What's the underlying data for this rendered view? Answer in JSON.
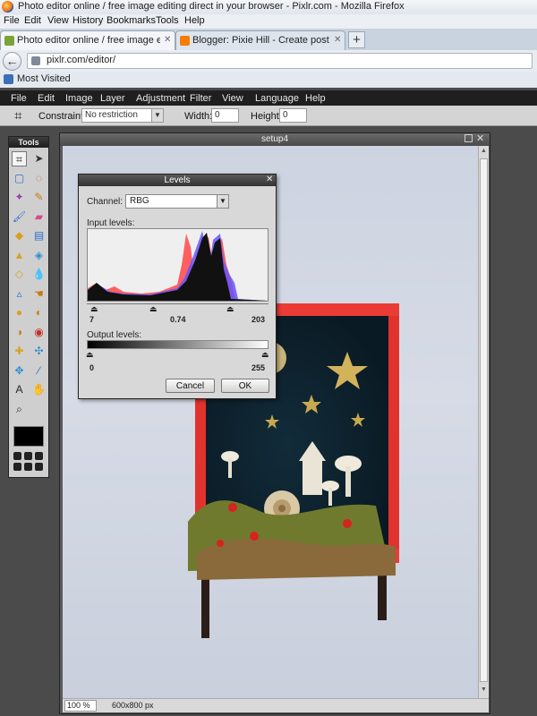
{
  "window": {
    "title": "Photo editor online / free image editing direct in your browser - Pixlr.com - Mozilla Firefox"
  },
  "browser_menu": [
    "File",
    "Edit",
    "View",
    "History",
    "Bookmarks",
    "Tools",
    "Help"
  ],
  "tabs": [
    {
      "label": "Photo editor online / free image editi...",
      "active": true
    },
    {
      "label": "Blogger: Pixie Hill - Create post",
      "active": false
    }
  ],
  "address": {
    "url": "pixlr.com/editor/"
  },
  "bookmarks": {
    "most_visited": "Most Visited"
  },
  "app_menu": [
    "File",
    "Edit",
    "Image",
    "Layer",
    "Adjustment",
    "Filter",
    "View",
    "Language",
    "Help"
  ],
  "options": {
    "constraint_label": "Constraint:",
    "constraint_value": "No restriction",
    "width_label": "Width:",
    "width_value": "0",
    "height_label": "Height:",
    "height_value": "0"
  },
  "tools_panel": {
    "title": "Tools",
    "icons": [
      "crop-icon",
      "move-icon",
      "marquee-icon",
      "lasso-icon",
      "wand-icon",
      "pencil-icon",
      "brush-icon",
      "eraser-icon",
      "bucket-icon",
      "gradient-icon",
      "stamp-icon",
      "color-replace-icon",
      "drawing-icon",
      "drop-icon",
      "sharpen-icon",
      "smudge-icon",
      "sponge-icon",
      "burn-icon",
      "dodge-icon",
      "redeye-icon",
      "spot-heal-icon",
      "bloat-icon",
      "pinch-icon",
      "eyedropper-icon",
      "text-icon",
      "hand-icon",
      "zoom-icon"
    ]
  },
  "image_window": {
    "title": "setup4",
    "zoom": "100",
    "zoom_unit": "%",
    "size": "600x800 px"
  },
  "levels": {
    "title": "Levels",
    "channel_label": "Channel:",
    "channel_value": "RBG",
    "input_label": "Input levels:",
    "input_black": "7",
    "input_gamma": "0.74",
    "input_white": "203",
    "output_label": "Output levels:",
    "output_black": "0",
    "output_white": "255",
    "cancel": "Cancel",
    "ok": "OK"
  }
}
